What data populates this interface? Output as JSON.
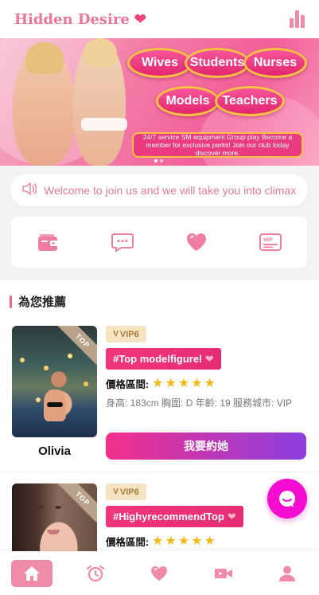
{
  "header": {
    "app_name": "Hidden Desire",
    "logo_heart_icon": "heart-icon",
    "stats_icon": "bar-chart-icon"
  },
  "banner": {
    "categories": [
      "Wives",
      "Students",
      "Nurses",
      "Models",
      "Teachers"
    ],
    "note": "24/7 service  SM equipment  Group play Become a member for exclusive perks! Join our club today discover more."
  },
  "notice": {
    "icon": "speaker-icon",
    "text": "Welcome to join us and we will take you into climax"
  },
  "quick_actions": [
    {
      "icon": "wallet-icon"
    },
    {
      "icon": "chat-bubble-icon"
    },
    {
      "icon": "heart-icon"
    },
    {
      "icon": "vip-card-icon"
    }
  ],
  "section": {
    "title": "為您推薦"
  },
  "cards": [
    {
      "ribbon": "TOP",
      "name": "Olivia",
      "vip": "VIP6",
      "title": "#Top modelfigurel",
      "price_label": "價格區間:",
      "stars": 5,
      "meta": "身高: 183cm 胸圍: D 年齡: 19 服務城市: VIP",
      "button": "我要約她"
    },
    {
      "ribbon": "TOP",
      "vip": "VIP6",
      "title": "#HighyrecommendTop",
      "price_label": "價格區間:",
      "stars": 5
    }
  ],
  "colors": {
    "brand_pink": "#e7769a",
    "accent": "#f1357a",
    "fab": "#f20dd1",
    "star": "#f5b916"
  },
  "tabbar": [
    {
      "icon": "home-icon",
      "active": true
    },
    {
      "icon": "alarm-clock-icon"
    },
    {
      "icon": "heart-icon"
    },
    {
      "icon": "video-camera-icon"
    },
    {
      "icon": "user-icon"
    }
  ]
}
